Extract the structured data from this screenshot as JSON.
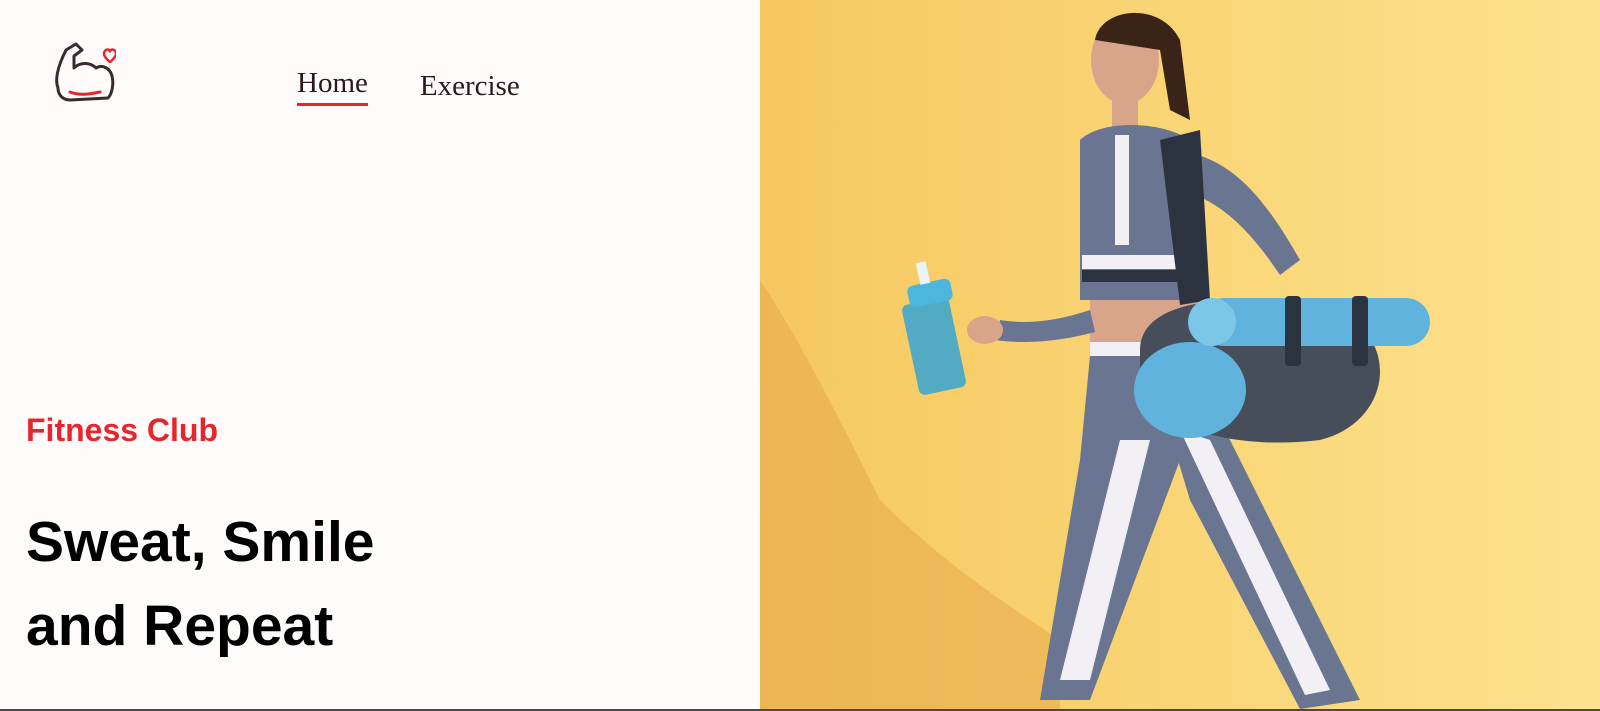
{
  "nav": {
    "items": [
      {
        "label": "Home",
        "active": true
      },
      {
        "label": "Exercise",
        "active": false
      }
    ]
  },
  "logo": {
    "icon": "flexed-arm-heart-icon"
  },
  "hero": {
    "eyebrow": "Fitness Club",
    "headline_line1": "Sweat, Smile",
    "headline_line2": "and Repeat",
    "image": "woman-walking-with-yoga-mat-and-shaker-photo"
  },
  "colors": {
    "accent": "#e5262d",
    "background": "#fffbfb",
    "hero_background": "#fbd67a",
    "headline": "#000000"
  }
}
